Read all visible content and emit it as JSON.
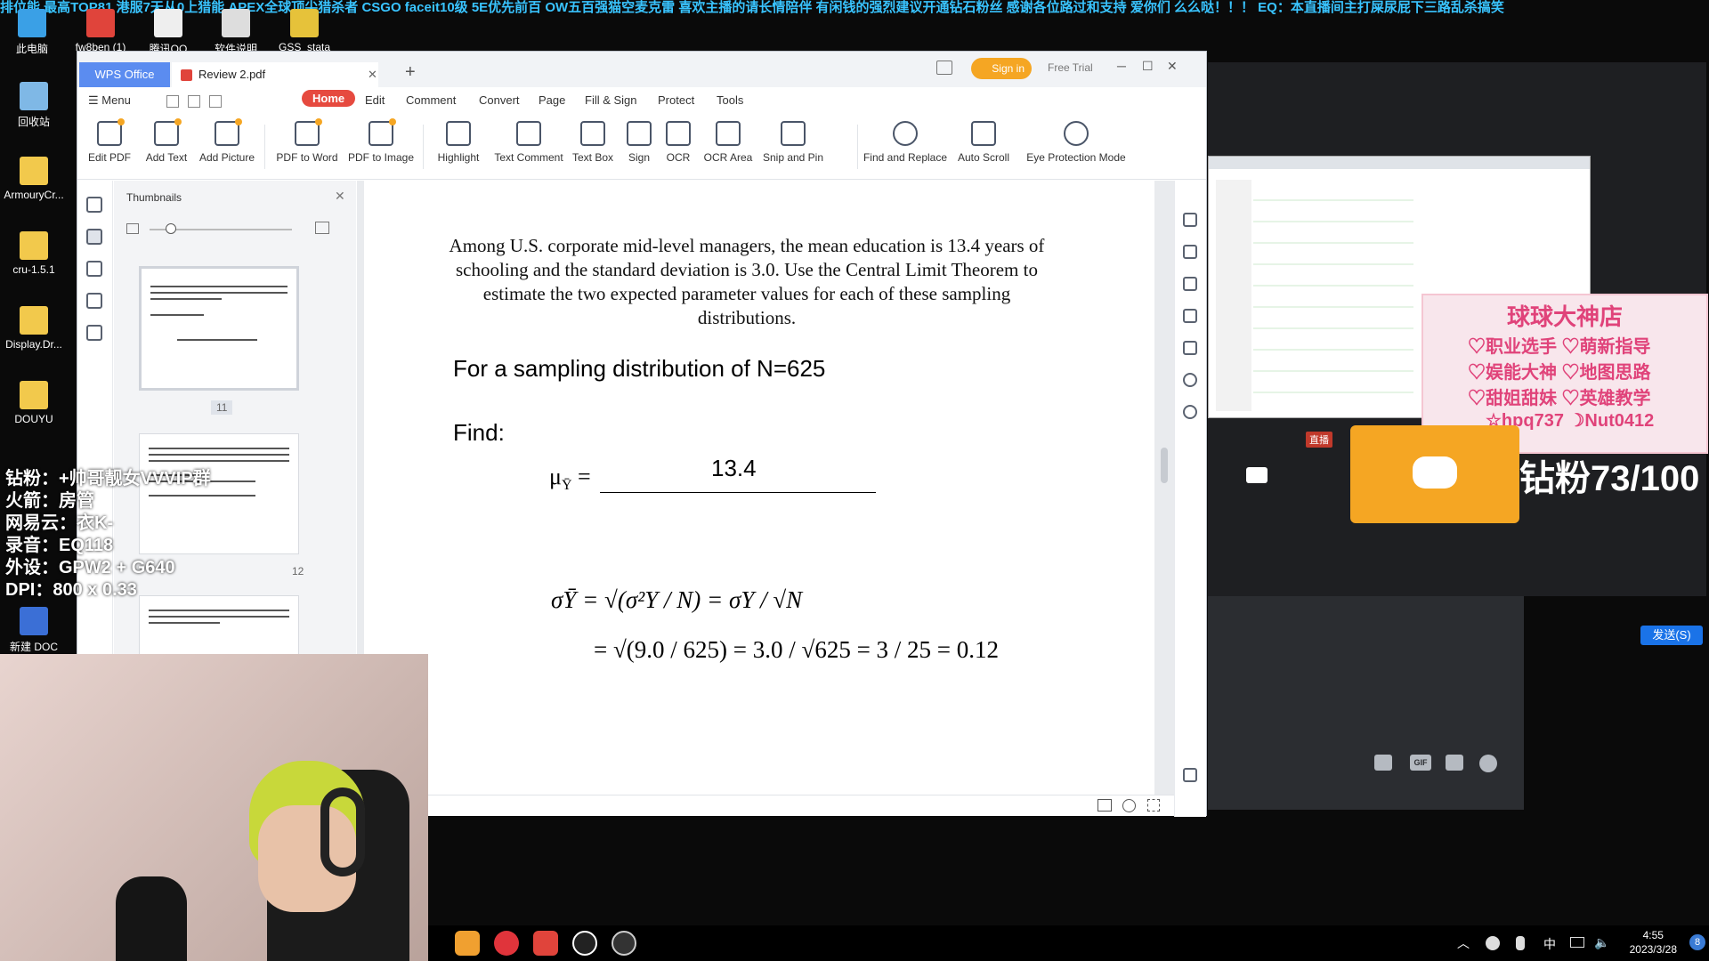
{
  "stream_marquee": "排位能 最高TOP81 港服7天从0上猎能 APEX全球顶尖猎杀者 CSGO faceit10级 5E优先前百 OW五百强猫空麦克雷 喜欢主播的请长情陪伴 有闲钱的强烈建议开通钻石粉丝 感谢各位路过和支持 爱你们 么么哒！！！    EQ：本直播间主打屎尿屁下三路乱杀搞笑",
  "desktop": {
    "icons": [
      "此电脑",
      "fw8ben (1)",
      "腾讯QQ",
      "软件说明",
      "GSS_stata",
      "回收站",
      "ArmouryCr...",
      "cru-1.5.1",
      "Display.Dr...",
      "DOUYU",
      "新建 DOC"
    ]
  },
  "window": {
    "wps_tab": "WPS Office",
    "doc_tab": "Review 2.pdf",
    "new_tab": "+",
    "sign_in": "Sign in",
    "free_trial": "Free Trial",
    "menu": [
      "Menu",
      "Home",
      "Edit",
      "Comment",
      "Convert",
      "Page",
      "Fill & Sign",
      "Protect",
      "Tools"
    ],
    "ribbon": [
      "Edit PDF",
      "Add Text",
      "Add Picture",
      "PDF to Word",
      "PDF to Image",
      "Highlight",
      "Text Comment",
      "Text Box",
      "Sign",
      "OCR",
      "OCR Area",
      "Snip and Pin",
      "Find and Replace",
      "Auto Scroll",
      "Eye Protection Mode"
    ]
  },
  "thumbnails": {
    "title": "Thumbnails",
    "pages": [
      "11",
      "12"
    ]
  },
  "document": {
    "paragraph": "Among U.S. corporate mid-level managers, the mean education is 13.4 years of schooling and the standard deviation is 3.0. Use the Central Limit Theorem to estimate the two expected parameter values for each of these sampling distributions.",
    "heading": "For a sampling distribution of N=625",
    "find": "Find:",
    "mu_label": "μ",
    "mu_sub": "Ȳ",
    "mu_value": "13.4",
    "sigma_line1": "σȲ = √(σ²Y / N) = σY / √N",
    "sigma_line2": "= √(9.0 / 625) = 3.0 / √625 = 3 / 25 = 0.12"
  },
  "right_panel": {
    "shop_lines": [
      "球球大神店",
      "♡职业选手 ♡萌新指导",
      "♡娱能大神 ♡地图思路",
      "♡甜姐甜妹 ♡英雄教学",
      "☆hpq737 ☽Nut0412"
    ],
    "live_badge": "直播",
    "fans_counter": "钻粉73/100",
    "send_button": "发送(S)",
    "gif_label": "GIF"
  },
  "overlay": [
    "钻粉：+帅哥靓女VVVIP群",
    "火箭：房管",
    "网易云：衣K-",
    "录音：EQ118",
    "外设：GPW2 + G640",
    "DPI：800 x 0.33"
  ],
  "taskbar": {
    "time": "4:55",
    "date": "2023/3/28",
    "ime": "中",
    "notif": "8"
  }
}
